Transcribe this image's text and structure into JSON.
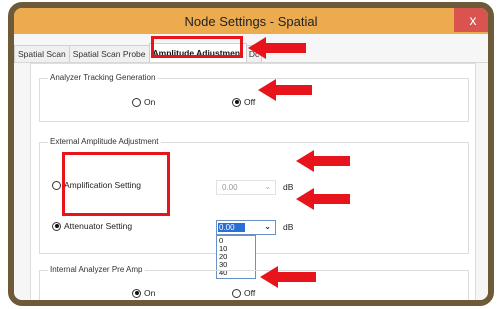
{
  "window": {
    "title": "Node Settings - Spatial",
    "close_glyph": "x"
  },
  "tabs": [
    {
      "label": "Spatial Scan"
    },
    {
      "label": "Spatial Scan Probe"
    },
    {
      "label": "Amplitude Adjustment"
    },
    {
      "label": "Dc"
    }
  ],
  "tracking": {
    "legend": "Analyzer Tracking Generation",
    "on_label": "On",
    "off_label": "Off",
    "selected": "Off"
  },
  "external": {
    "legend": "External Amplitude Adjustment",
    "amplification_label": "Amplification Setting",
    "attenuator_label": "Attenuator Setting",
    "selected": "Attenuator Setting",
    "amplification_value": "0.00",
    "attenuator_value": "0.00",
    "unit": "dB",
    "attenuator_options": [
      "0",
      "10",
      "20",
      "30",
      "40"
    ]
  },
  "preamp": {
    "legend": "Internal Analyzer Pre Amp",
    "on_label": "On",
    "off_label": "Off",
    "selected": "On"
  },
  "annotation_color": "#e8141c"
}
